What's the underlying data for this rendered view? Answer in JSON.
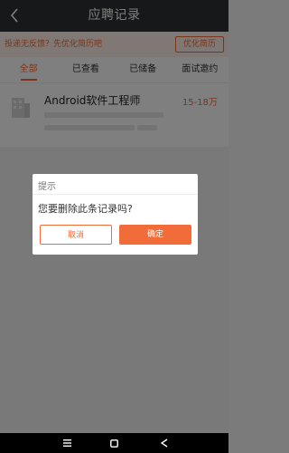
{
  "header": {
    "title": "应聘记录",
    "back_icon": "chevron-left-icon"
  },
  "notice": {
    "text": "投递无反馈？先优化简历吧",
    "button": "优化简历"
  },
  "tabs": [
    {
      "label": "全部",
      "active": true
    },
    {
      "label": "已查看",
      "active": false
    },
    {
      "label": "已储备",
      "active": false
    },
    {
      "label": "面试邀约",
      "active": false
    }
  ],
  "job": {
    "title": "Android软件工程师",
    "salary": "15-18万"
  },
  "dialog": {
    "title": "提示",
    "message": "您要删除此条记录吗?",
    "cancel": "取消",
    "confirm": "确定"
  },
  "navbar": {
    "menu_icon": "menu-icon",
    "home_icon": "home-square-icon",
    "back_icon": "back-triangle-icon"
  },
  "colors": {
    "accent": "#f16c38",
    "topbar": "#2f3034"
  }
}
